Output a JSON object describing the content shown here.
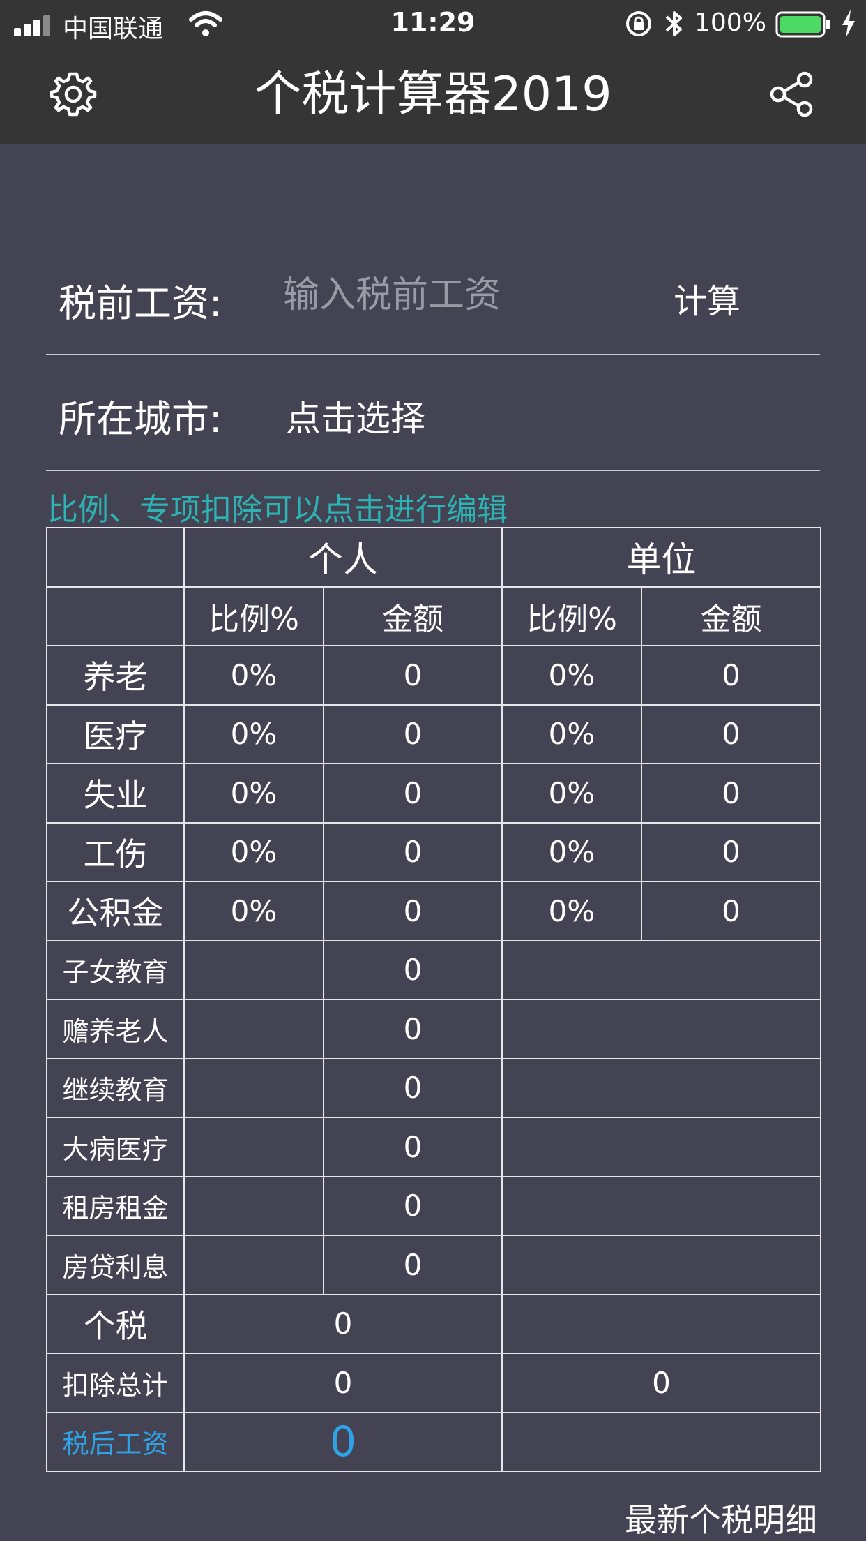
{
  "status_bar": {
    "carrier": "中国联通",
    "time": "11:29",
    "battery_percent": "100%"
  },
  "header": {
    "title": "个税计算器2019",
    "left_icon": "gear-icon",
    "right_icon": "share-icon"
  },
  "salary": {
    "label": "税前工资:",
    "placeholder": "输入税前工资",
    "value": "",
    "calc_label": "计算"
  },
  "city": {
    "label": "所在城市:",
    "value": "点击选择"
  },
  "hint": "比例、专项扣除可以点击进行编辑",
  "table": {
    "group_personal": "个人",
    "group_company": "单位",
    "col_ratio": "比例%",
    "col_amount": "金额",
    "insurance_rows": [
      {
        "label": "养老",
        "p_ratio": "0%",
        "p_amount": "0",
        "c_ratio": "0%",
        "c_amount": "0"
      },
      {
        "label": "医疗",
        "p_ratio": "0%",
        "p_amount": "0",
        "c_ratio": "0%",
        "c_amount": "0"
      },
      {
        "label": "失业",
        "p_ratio": "0%",
        "p_amount": "0",
        "c_ratio": "0%",
        "c_amount": "0"
      },
      {
        "label": "工伤",
        "p_ratio": "0%",
        "p_amount": "0",
        "c_ratio": "0%",
        "c_amount": "0"
      },
      {
        "label": "公积金",
        "p_ratio": "0%",
        "p_amount": "0",
        "c_ratio": "0%",
        "c_amount": "0"
      }
    ],
    "deduction_rows": [
      {
        "label": "子女教育",
        "amount": "0"
      },
      {
        "label": "赡养老人",
        "amount": "0"
      },
      {
        "label": "继续教育",
        "amount": "0"
      },
      {
        "label": "大病医疗",
        "amount": "0"
      },
      {
        "label": "租房租金",
        "amount": "0"
      },
      {
        "label": "房贷利息",
        "amount": "0"
      }
    ],
    "tax": {
      "label": "个税",
      "value": "0"
    },
    "total_deduction": {
      "label": "扣除总计",
      "personal": "0",
      "company": "0"
    },
    "after_tax": {
      "label": "税后工资",
      "value": "0"
    }
  },
  "footer": {
    "link": "最新个税明细"
  },
  "colors": {
    "background": "#434353",
    "topbar": "#353535",
    "hint": "#2db3b3",
    "accent": "#2fa3e6",
    "battery": "#4cd964"
  }
}
